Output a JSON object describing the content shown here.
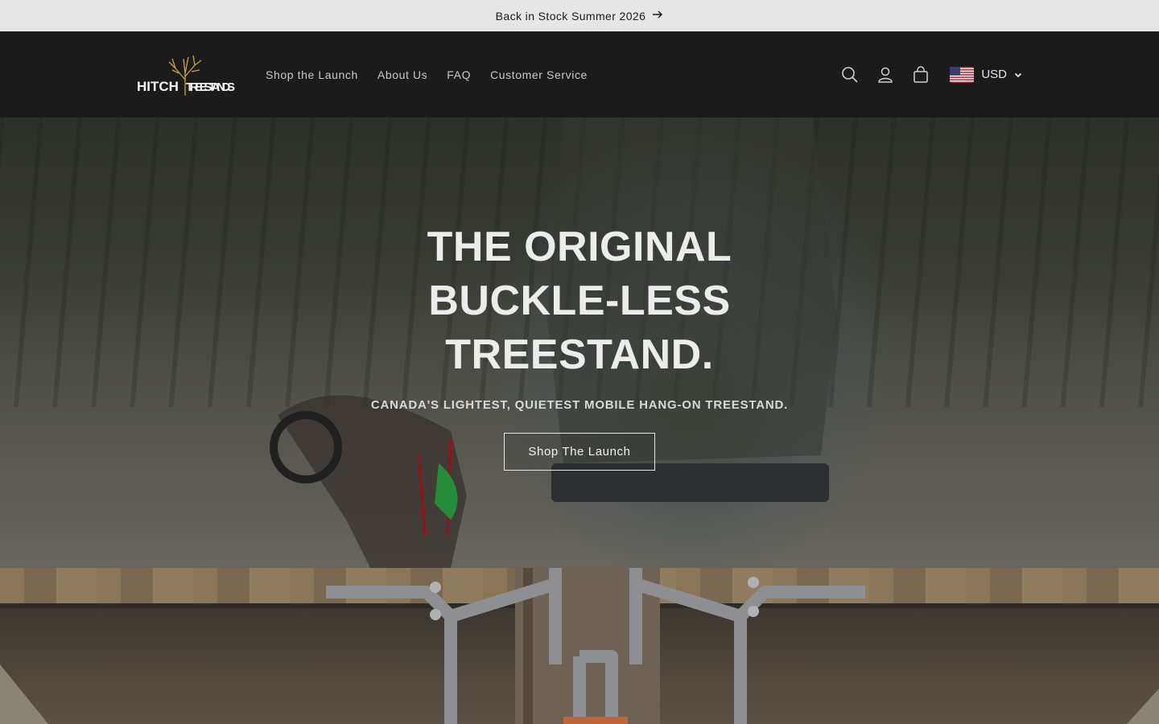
{
  "announcement": {
    "text": "Back in Stock Summer 2026",
    "arrow_icon": "arrow-right-icon"
  },
  "header": {
    "logo_text_1": "HITCH",
    "logo_text_2": "TREESTANDS",
    "nav": [
      {
        "label": "Shop the Launch"
      },
      {
        "label": "About Us"
      },
      {
        "label": "FAQ"
      },
      {
        "label": "Customer Service"
      }
    ],
    "icons": [
      "search-icon",
      "account-icon",
      "cart-icon"
    ],
    "currency": {
      "code": "USD",
      "flag": "us-flag-icon"
    }
  },
  "hero": {
    "title_lines": [
      "THE ORIGINAL",
      "BUCKLE-LESS",
      "TREESTAND."
    ],
    "subtitle": "CANADA'S LIGHTEST, QUIETEST MOBILE HANG-ON TREESTAND.",
    "button_label": "Shop The Launch"
  },
  "colors": {
    "announcement_bg": "#e6e6e6",
    "header_bg": "#1b1b1b",
    "nav_text": "#c8c8c8",
    "logo_accent": "#c9a24a"
  }
}
